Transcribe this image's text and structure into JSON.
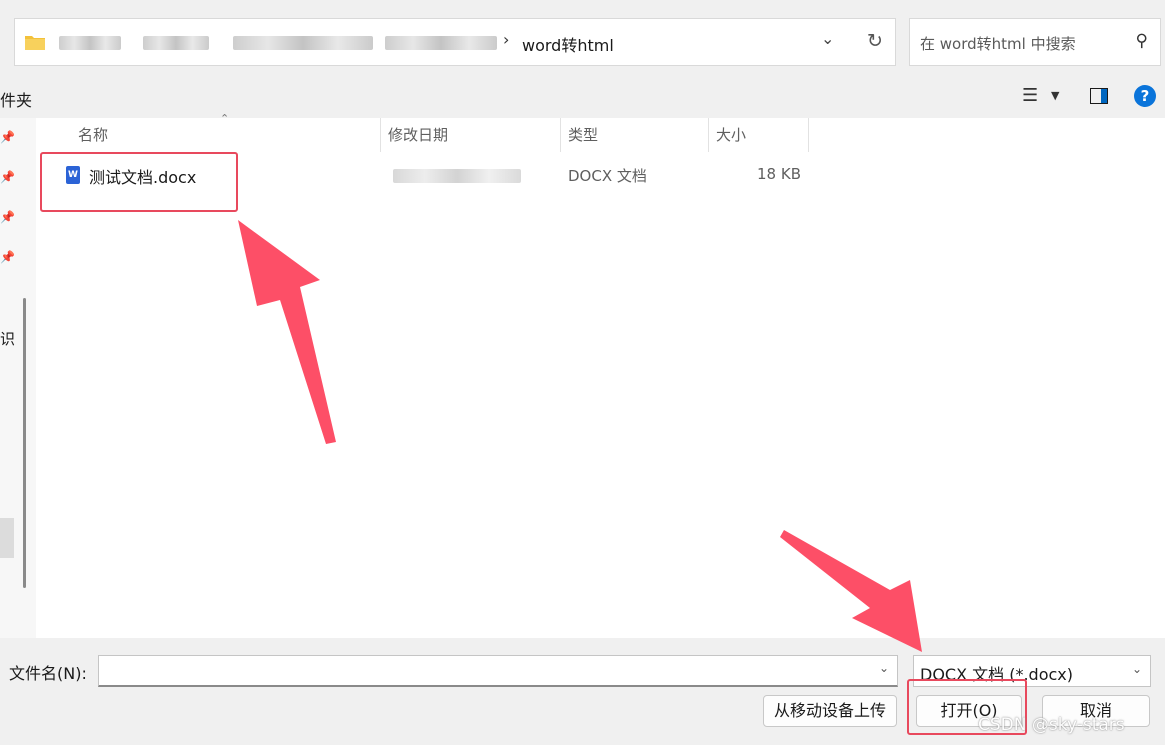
{
  "address_bar": {
    "current_folder": "word转html",
    "breadcrumb_separator": "›"
  },
  "search": {
    "placeholder": "在 word转html 中搜索"
  },
  "toolbar": {
    "left_label": "件夹"
  },
  "nav": {
    "partial_label": "识"
  },
  "columns": {
    "name": "名称",
    "date_modified": "修改日期",
    "type": "类型",
    "size": "大小"
  },
  "files": [
    {
      "name": "测试文档.docx",
      "type": "DOCX 文档",
      "size": "18 KB",
      "icon": "word-doc-icon"
    }
  ],
  "bottom": {
    "filename_label": "文件名(N):",
    "filename_value": "",
    "filetype_value": "DOCX 文档 (*.docx)",
    "upload_label": "从移动设备上传",
    "open_label": "打开(O)",
    "cancel_label": "取消"
  },
  "watermark": "CSDN @sky-stars",
  "colors": {
    "accent": "#0067c0",
    "annotation": "#e8495d",
    "word_blue": "#2b63d6"
  }
}
